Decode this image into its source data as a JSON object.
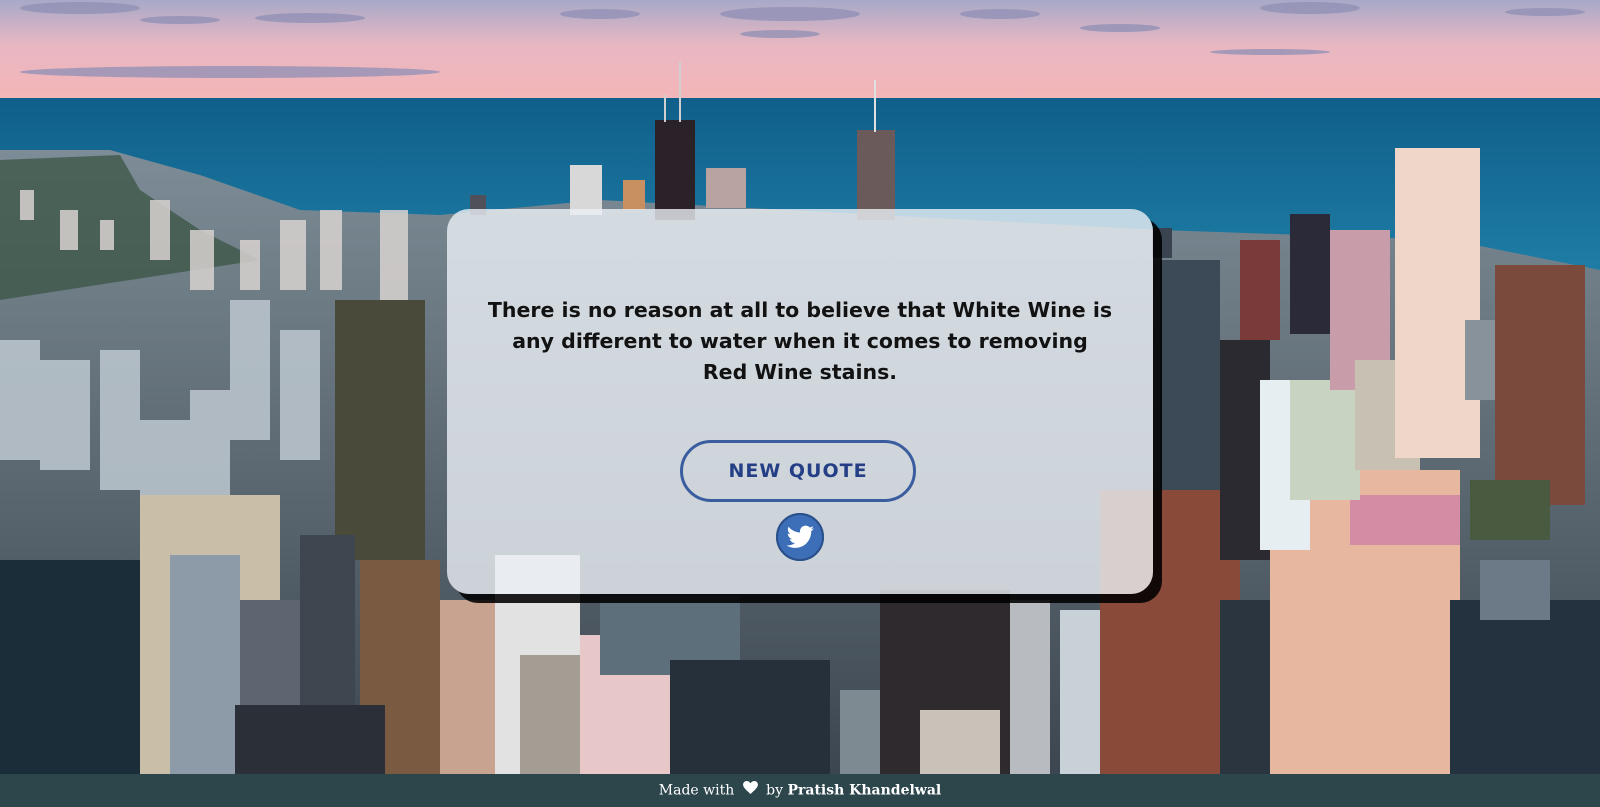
{
  "quote": {
    "text": "There is no reason at all to believe that White Wine is any different to water when it comes to removing Red Wine stains."
  },
  "buttons": {
    "new_quote_label": "NEW QUOTE",
    "tweet_icon": "twitter-bird-icon"
  },
  "footer": {
    "prefix": "Made with",
    "heart_icon": "heart-icon",
    "by_text": "by",
    "author": "Pratish Khandelwal"
  },
  "colors": {
    "button_border": "#3a5da0",
    "button_text": "#253f86",
    "footer_bg": "#2d464c",
    "card_bg": "rgba(235,240,245,0.80)"
  }
}
